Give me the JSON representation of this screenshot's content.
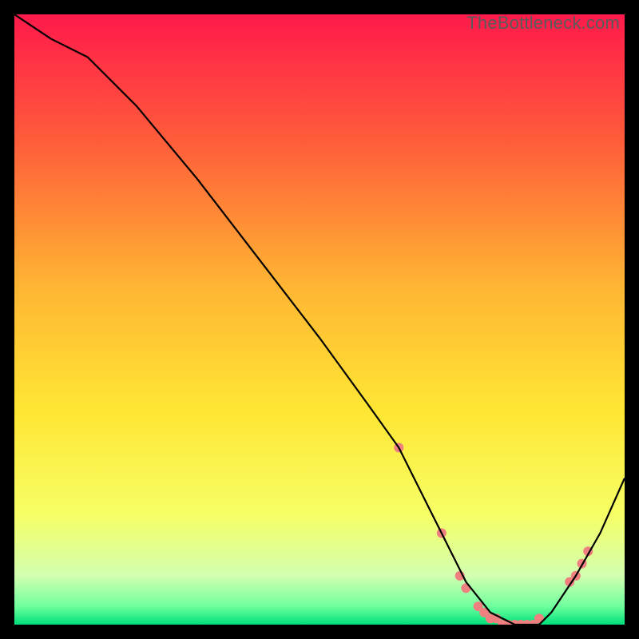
{
  "watermark": "TheBottleneck.com",
  "chart_data": {
    "type": "line",
    "title": "",
    "xlabel": "",
    "ylabel": "",
    "xlim": [
      0,
      100
    ],
    "ylim": [
      0,
      100
    ],
    "background_gradient": {
      "stops": [
        {
          "offset": 0.0,
          "color": "#ff1a4b"
        },
        {
          "offset": 0.2,
          "color": "#ff5a3a"
        },
        {
          "offset": 0.45,
          "color": "#ffb733"
        },
        {
          "offset": 0.65,
          "color": "#ffe633"
        },
        {
          "offset": 0.82,
          "color": "#f6ff66"
        },
        {
          "offset": 0.92,
          "color": "#d2ffb0"
        },
        {
          "offset": 0.97,
          "color": "#6fff9e"
        },
        {
          "offset": 1.0,
          "color": "#00e07a"
        }
      ]
    },
    "series": [
      {
        "name": "bottleneck-curve",
        "color": "#000000",
        "x": [
          0,
          6,
          12,
          20,
          30,
          40,
          50,
          58,
          63,
          66,
          70,
          74,
          78,
          82,
          86,
          88,
          92,
          96,
          100
        ],
        "y": [
          100,
          96,
          93,
          85,
          73,
          60,
          47,
          36,
          29,
          23,
          15,
          7,
          2,
          0,
          0,
          2,
          8,
          15,
          24
        ]
      }
    ],
    "markers": {
      "name": "highlight-dots",
      "color": "#f08080",
      "radius": 6,
      "points": [
        {
          "x": 63,
          "y": 29
        },
        {
          "x": 70,
          "y": 15
        },
        {
          "x": 73,
          "y": 8
        },
        {
          "x": 74,
          "y": 6
        },
        {
          "x": 76,
          "y": 3
        },
        {
          "x": 77,
          "y": 2
        },
        {
          "x": 78,
          "y": 1
        },
        {
          "x": 79,
          "y": 1
        },
        {
          "x": 80,
          "y": 0
        },
        {
          "x": 81,
          "y": 0
        },
        {
          "x": 82,
          "y": 0
        },
        {
          "x": 83,
          "y": 0
        },
        {
          "x": 84,
          "y": 0
        },
        {
          "x": 85,
          "y": 0
        },
        {
          "x": 86,
          "y": 1
        },
        {
          "x": 91,
          "y": 7
        },
        {
          "x": 92,
          "y": 8
        },
        {
          "x": 93,
          "y": 10
        },
        {
          "x": 94,
          "y": 12
        }
      ]
    }
  }
}
